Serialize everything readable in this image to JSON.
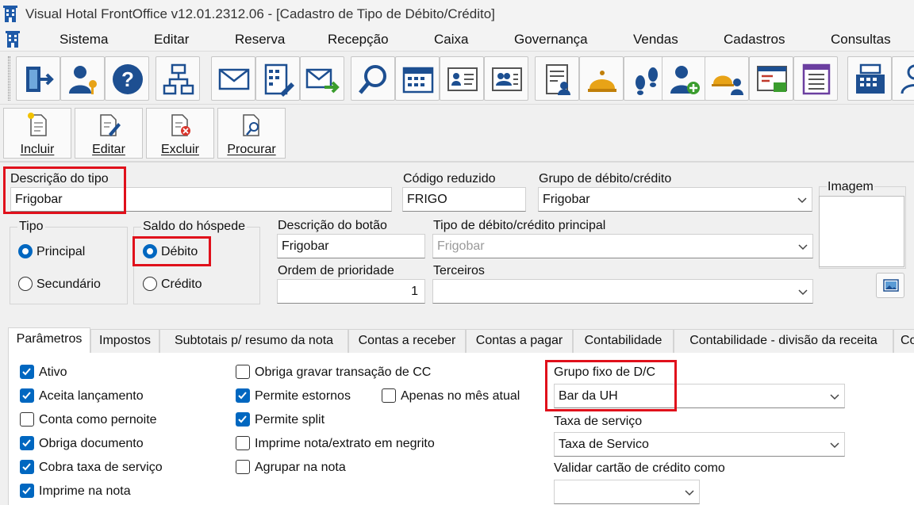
{
  "window": {
    "title": "Visual Hotal FrontOffice v12.01.2312.06 - [Cadastro de Tipo de Débito/Crédito]"
  },
  "menu": [
    "Sistema",
    "Editar",
    "Reserva",
    "Recepção",
    "Caixa",
    "Governança",
    "Vendas",
    "Cadastros",
    "Consultas"
  ],
  "toolbar_icons": [
    "exit-icon",
    "user-key-icon",
    "help-icon",
    "org-chart-icon",
    "mail-icon",
    "calculator-edit-icon",
    "mail-forward-icon",
    "search-icon",
    "calendar-icon",
    "guest-card-icon",
    "group-card-icon",
    "guest-list-icon",
    "bell-icon",
    "footsteps-icon",
    "add-user-icon",
    "bell-guests-icon",
    "cash-register-report-icon",
    "list-icon",
    "cash-register-icon",
    "guest-icon"
  ],
  "actions": {
    "include": "Incluir",
    "edit": "Editar",
    "delete": "Excluir",
    "search": "Procurar"
  },
  "form": {
    "descricao_label": "Descrição do tipo",
    "descricao_value": "Frigobar",
    "codigo_label": "Código reduzido",
    "codigo_value": "FRIGO",
    "grupo_label": "Grupo de débito/crédito",
    "grupo_value": "Frigobar",
    "imagem_label": "Imagem",
    "tipo_label": "Tipo",
    "tipo_principal": "Principal",
    "tipo_secundario": "Secundário",
    "tipo_selected": "Principal",
    "saldo_label": "Saldo do hóspede",
    "saldo_debito": "Débito",
    "saldo_credito": "Crédito",
    "saldo_selected": "Débito",
    "botao_label": "Descrição do botão",
    "botao_value": "Frigobar",
    "tipo_principal_label": "Tipo de débito/crédito principal",
    "tipo_principal_value": "Frigobar",
    "ordem_label": "Ordem de prioridade",
    "ordem_value": "1",
    "terceiros_label": "Terceiros",
    "terceiros_value": ""
  },
  "tabs": [
    "Parâmetros",
    "Impostos",
    "Subtotais p/ resumo da nota",
    "Contas a receber",
    "Contas a pagar",
    "Contabilidade",
    "Contabilidade - divisão da receita",
    "Co"
  ],
  "params": {
    "col1": [
      {
        "label": "Ativo",
        "checked": true
      },
      {
        "label": "Aceita lançamento",
        "checked": true
      },
      {
        "label": "Conta como pernoite",
        "checked": false
      },
      {
        "label": "Obriga documento",
        "checked": true
      },
      {
        "label": "Cobra taxa de serviço",
        "checked": true
      },
      {
        "label": "Imprime na nota",
        "checked": true
      }
    ],
    "col2": [
      {
        "label": "Obriga gravar transação de CC",
        "checked": false
      },
      {
        "label": "Permite estornos",
        "checked": true
      },
      {
        "label": "Permite split",
        "checked": true
      },
      {
        "label": "Imprime nota/extrato em negrito",
        "checked": false
      },
      {
        "label": "Agrupar na nota",
        "checked": false
      }
    ],
    "apenas": {
      "label": "Apenas no mês atual",
      "checked": false
    },
    "grupo_fixo_label": "Grupo fixo de D/C",
    "grupo_fixo_value": "Bar da UH",
    "taxa_label": "Taxa de serviço",
    "taxa_value": "Taxa de Servico",
    "validar_label": "Validar cartão de crédito como",
    "validar_value": ""
  },
  "colors": {
    "accent": "#0067c0",
    "highlight": "#e0101b"
  }
}
